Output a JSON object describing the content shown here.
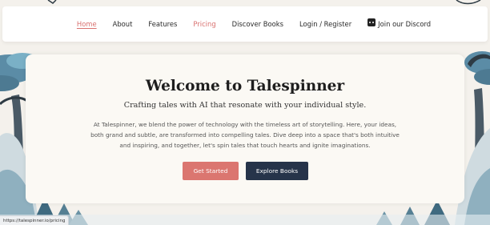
{
  "nav": {
    "items": [
      {
        "label": "Home",
        "state": "active"
      },
      {
        "label": "About"
      },
      {
        "label": "Features"
      },
      {
        "label": "Pricing",
        "state": "highlighted"
      },
      {
        "label": "Discover Books"
      },
      {
        "label": "Login / Register"
      }
    ],
    "discord_label": "Join our Discord",
    "discord_icon": "discord-icon"
  },
  "hero": {
    "title": "Welcome to Talespinner",
    "subtitle": "Crafting tales with AI that resonate with your individual style.",
    "body": "At Talespinner, we blend the power of technology with the timeless art of storytelling. Here, your ideas, both grand and subtle, are transformed into compelling tales. Dive deep into a space that's both intuitive and inspiring, and together, let's spin tales that touch hearts and ignite imaginations.",
    "primary_button": "Get Started",
    "secondary_button": "Explore Books"
  },
  "status_bar": {
    "url": "https://talespinner.io/pricing"
  },
  "colors": {
    "accent": "#db7670",
    "dark_button": "#26344a",
    "background": "#f4f1ec"
  }
}
